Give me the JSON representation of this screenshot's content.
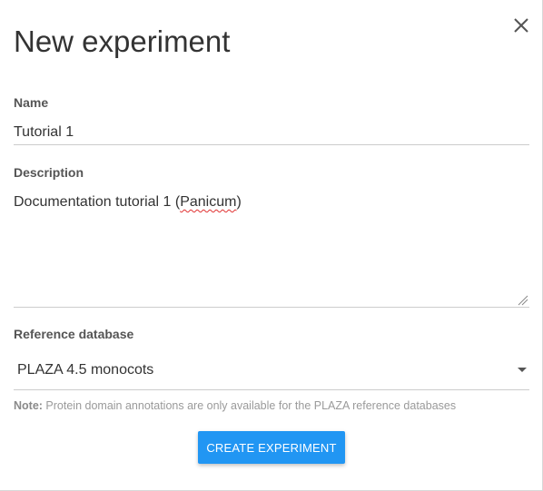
{
  "dialog": {
    "title": "New experiment",
    "close_icon": "close-icon"
  },
  "form": {
    "name_label": "Name",
    "name_value": "Tutorial 1",
    "description_label": "Description",
    "description_prefix": "Documentation tutorial 1 (",
    "description_misspelled": "Panicum",
    "description_suffix": ")",
    "reference_label": "Reference database",
    "reference_value": "PLAZA 4.5 monocots",
    "note_label": "Note:",
    "note_text": " Protein domain annotations are only available for the PLAZA reference databases",
    "submit_label": "CREATE EXPERIMENT"
  },
  "colors": {
    "accent": "#2196f3",
    "spellcheck": "#e03030"
  }
}
